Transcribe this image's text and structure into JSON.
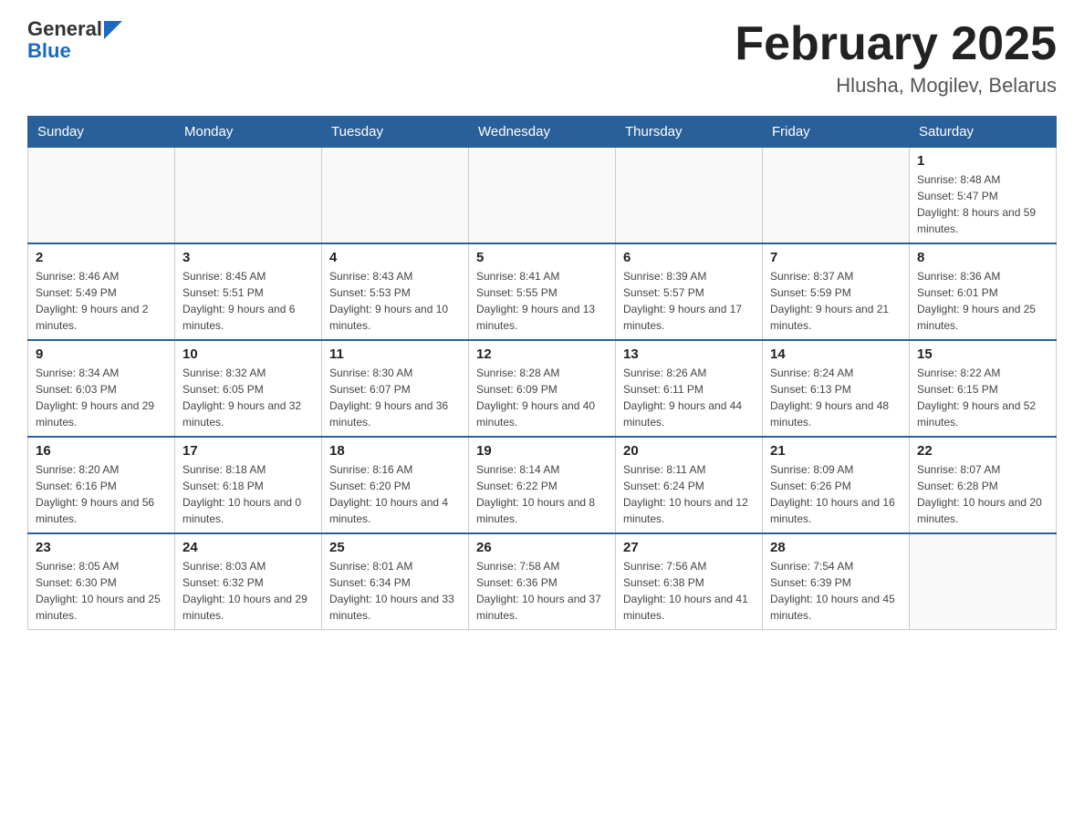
{
  "header": {
    "logo": {
      "general": "General",
      "blue": "Blue",
      "arrow": "▶"
    },
    "month": "February 2025",
    "location": "Hlusha, Mogilev, Belarus"
  },
  "weekdays": [
    "Sunday",
    "Monday",
    "Tuesday",
    "Wednesday",
    "Thursday",
    "Friday",
    "Saturday"
  ],
  "weeks": [
    [
      {
        "day": "",
        "info": ""
      },
      {
        "day": "",
        "info": ""
      },
      {
        "day": "",
        "info": ""
      },
      {
        "day": "",
        "info": ""
      },
      {
        "day": "",
        "info": ""
      },
      {
        "day": "",
        "info": ""
      },
      {
        "day": "1",
        "info": "Sunrise: 8:48 AM\nSunset: 5:47 PM\nDaylight: 8 hours and 59 minutes."
      }
    ],
    [
      {
        "day": "2",
        "info": "Sunrise: 8:46 AM\nSunset: 5:49 PM\nDaylight: 9 hours and 2 minutes."
      },
      {
        "day": "3",
        "info": "Sunrise: 8:45 AM\nSunset: 5:51 PM\nDaylight: 9 hours and 6 minutes."
      },
      {
        "day": "4",
        "info": "Sunrise: 8:43 AM\nSunset: 5:53 PM\nDaylight: 9 hours and 10 minutes."
      },
      {
        "day": "5",
        "info": "Sunrise: 8:41 AM\nSunset: 5:55 PM\nDaylight: 9 hours and 13 minutes."
      },
      {
        "day": "6",
        "info": "Sunrise: 8:39 AM\nSunset: 5:57 PM\nDaylight: 9 hours and 17 minutes."
      },
      {
        "day": "7",
        "info": "Sunrise: 8:37 AM\nSunset: 5:59 PM\nDaylight: 9 hours and 21 minutes."
      },
      {
        "day": "8",
        "info": "Sunrise: 8:36 AM\nSunset: 6:01 PM\nDaylight: 9 hours and 25 minutes."
      }
    ],
    [
      {
        "day": "9",
        "info": "Sunrise: 8:34 AM\nSunset: 6:03 PM\nDaylight: 9 hours and 29 minutes."
      },
      {
        "day": "10",
        "info": "Sunrise: 8:32 AM\nSunset: 6:05 PM\nDaylight: 9 hours and 32 minutes."
      },
      {
        "day": "11",
        "info": "Sunrise: 8:30 AM\nSunset: 6:07 PM\nDaylight: 9 hours and 36 minutes."
      },
      {
        "day": "12",
        "info": "Sunrise: 8:28 AM\nSunset: 6:09 PM\nDaylight: 9 hours and 40 minutes."
      },
      {
        "day": "13",
        "info": "Sunrise: 8:26 AM\nSunset: 6:11 PM\nDaylight: 9 hours and 44 minutes."
      },
      {
        "day": "14",
        "info": "Sunrise: 8:24 AM\nSunset: 6:13 PM\nDaylight: 9 hours and 48 minutes."
      },
      {
        "day": "15",
        "info": "Sunrise: 8:22 AM\nSunset: 6:15 PM\nDaylight: 9 hours and 52 minutes."
      }
    ],
    [
      {
        "day": "16",
        "info": "Sunrise: 8:20 AM\nSunset: 6:16 PM\nDaylight: 9 hours and 56 minutes."
      },
      {
        "day": "17",
        "info": "Sunrise: 8:18 AM\nSunset: 6:18 PM\nDaylight: 10 hours and 0 minutes."
      },
      {
        "day": "18",
        "info": "Sunrise: 8:16 AM\nSunset: 6:20 PM\nDaylight: 10 hours and 4 minutes."
      },
      {
        "day": "19",
        "info": "Sunrise: 8:14 AM\nSunset: 6:22 PM\nDaylight: 10 hours and 8 minutes."
      },
      {
        "day": "20",
        "info": "Sunrise: 8:11 AM\nSunset: 6:24 PM\nDaylight: 10 hours and 12 minutes."
      },
      {
        "day": "21",
        "info": "Sunrise: 8:09 AM\nSunset: 6:26 PM\nDaylight: 10 hours and 16 minutes."
      },
      {
        "day": "22",
        "info": "Sunrise: 8:07 AM\nSunset: 6:28 PM\nDaylight: 10 hours and 20 minutes."
      }
    ],
    [
      {
        "day": "23",
        "info": "Sunrise: 8:05 AM\nSunset: 6:30 PM\nDaylight: 10 hours and 25 minutes."
      },
      {
        "day": "24",
        "info": "Sunrise: 8:03 AM\nSunset: 6:32 PM\nDaylight: 10 hours and 29 minutes."
      },
      {
        "day": "25",
        "info": "Sunrise: 8:01 AM\nSunset: 6:34 PM\nDaylight: 10 hours and 33 minutes."
      },
      {
        "day": "26",
        "info": "Sunrise: 7:58 AM\nSunset: 6:36 PM\nDaylight: 10 hours and 37 minutes."
      },
      {
        "day": "27",
        "info": "Sunrise: 7:56 AM\nSunset: 6:38 PM\nDaylight: 10 hours and 41 minutes."
      },
      {
        "day": "28",
        "info": "Sunrise: 7:54 AM\nSunset: 6:39 PM\nDaylight: 10 hours and 45 minutes."
      },
      {
        "day": "",
        "info": ""
      }
    ]
  ]
}
